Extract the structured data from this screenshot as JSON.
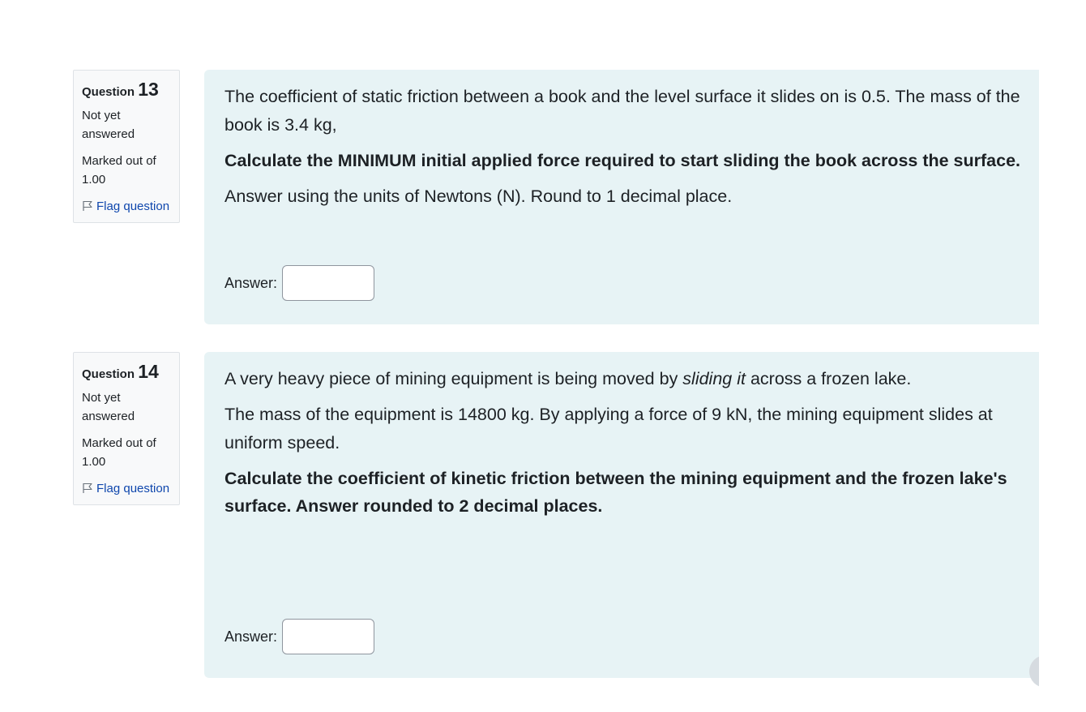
{
  "questions": [
    {
      "label": "Question",
      "number": "13",
      "state": "Not yet answered",
      "grade": "Marked out of 1.00",
      "flag": "Flag question",
      "paragraphs": [
        "The coefficient of static friction between a book and the level surface it slides on is 0.5.  The mass of the book is 3.4 kg,",
        "Calculate the MINIMUM initial applied force required to start sliding the book across the surface.",
        "Answer using the units of Newtons (N).  Round to 1 decimal place."
      ],
      "answer_label": "Answer:",
      "answer_value": ""
    },
    {
      "label": "Question",
      "number": "14",
      "state": "Not yet answered",
      "grade": "Marked out of 1.00",
      "flag": "Flag question",
      "para1_before": "A very heavy piece of mining equipment is being moved by ",
      "para1_italic": "sliding it",
      "para1_after": " across a frozen lake.",
      "para2": "The mass of the equipment is 14800 kg.  By applying a force of 9 kN, the mining equipment slides at uniform speed.",
      "para3": "Calculate the coefficient of kinetic friction between the mining equipment and the frozen lake's surface.  Answer rounded to 2 decimal places.",
      "answer_label": "Answer:",
      "answer_value": ""
    }
  ],
  "icons": {
    "flag": "flag-icon"
  }
}
